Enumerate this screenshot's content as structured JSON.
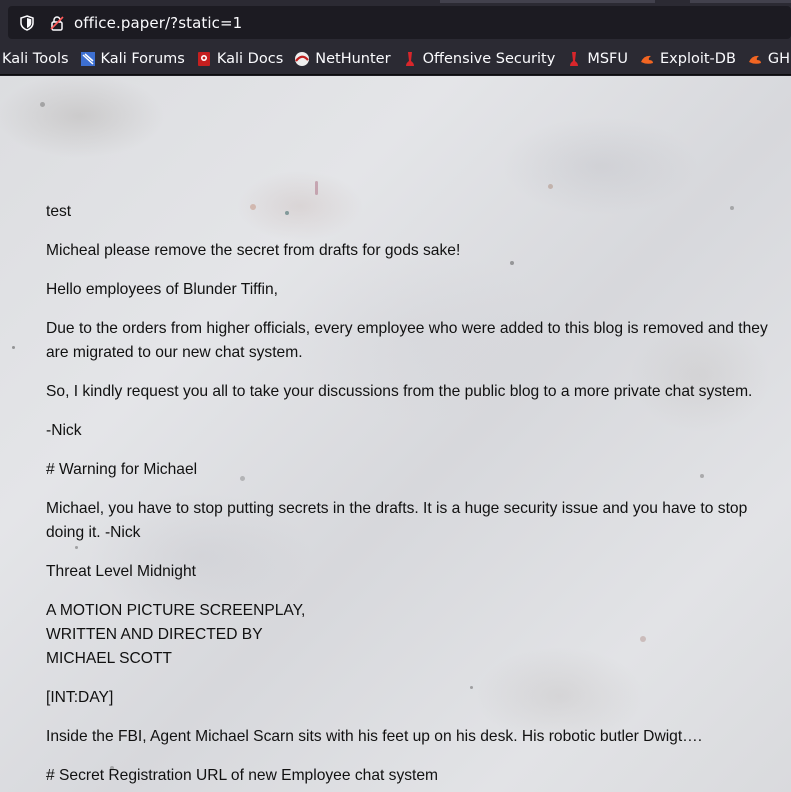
{
  "browser": {
    "url": "office.paper/?static=1"
  },
  "bookmarks": [
    {
      "label": "Kali Tools",
      "icon": "none"
    },
    {
      "label": "Kali Forums",
      "icon": "kali-forums-icon"
    },
    {
      "label": "Kali Docs",
      "icon": "kali-docs-icon"
    },
    {
      "label": "NetHunter",
      "icon": "nethunter-icon"
    },
    {
      "label": "Offensive Security",
      "icon": "offsec-icon"
    },
    {
      "label": "MSFU",
      "icon": "msfu-icon"
    },
    {
      "label": "Exploit-DB",
      "icon": "exploitdb-icon"
    },
    {
      "label": "GHDB",
      "icon": "ghdb-icon"
    }
  ],
  "content": {
    "p1": "test",
    "p2": "Micheal please remove the secret from drafts for gods sake!",
    "p3": "Hello employees of Blunder Tiffin,",
    "p4": "Due to the orders from higher officials, every employee who were added to this blog is removed and they are migrated to our new chat system.",
    "p5": "So, I kindly request you all to take your discussions from the public blog to a more private chat system.",
    "p6": "-Nick",
    "p7": "# Warning for Michael",
    "p8": "Michael, you have to stop putting secrets in the drafts. It is a huge security issue and you have to stop doing it. -Nick",
    "p9": "Threat Level Midnight",
    "p10_line1": "A MOTION PICTURE SCREENPLAY,",
    "p10_line2": "WRITTEN AND DIRECTED BY",
    "p10_line3": "MICHAEL SCOTT",
    "p11": "[INT:DAY]",
    "p12": "Inside the FBI, Agent Michael Scarn sits with his feet up on his desk. His robotic butler Dwigt….",
    "p13": "# Secret Registration URL of new Employee chat system"
  }
}
